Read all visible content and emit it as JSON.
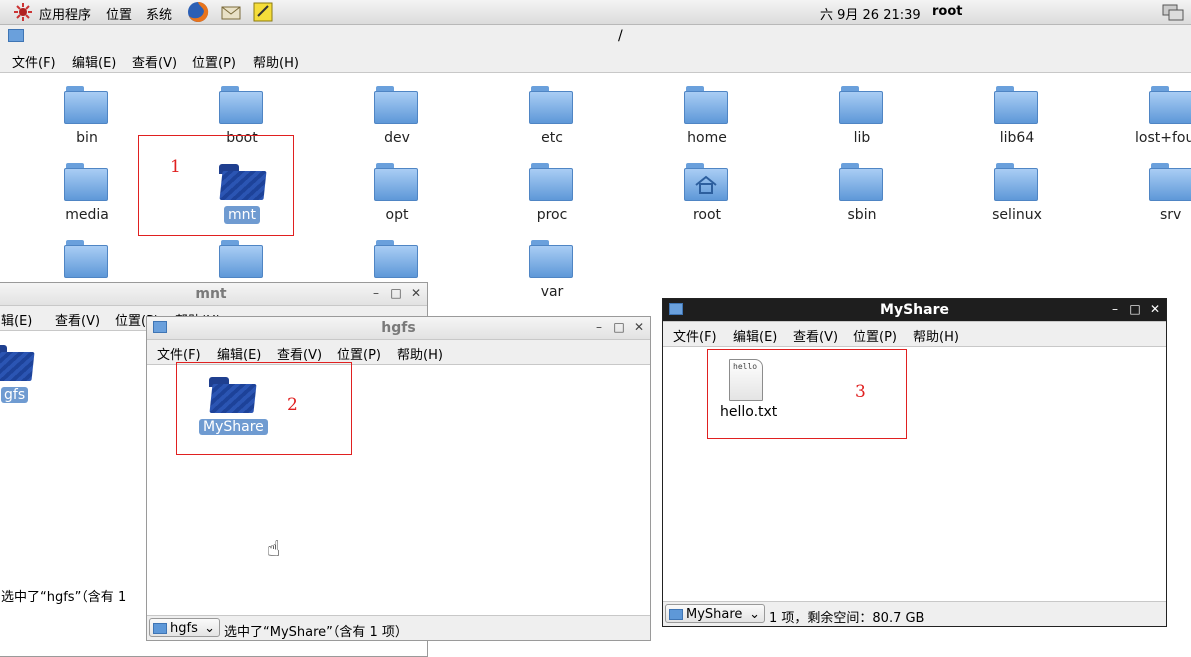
{
  "top_panel": {
    "menus": [
      "应用程序",
      "位置",
      "系统"
    ],
    "clock": "六 9月 26 21:39",
    "user": "root",
    "launchers": [
      "apps-menu-icon",
      "firefox-icon",
      "mail-icon",
      "notes-icon"
    ]
  },
  "main_window": {
    "path": "/",
    "menu": [
      "文件(F)",
      "编辑(E)",
      "查看(V)",
      "位置(P)",
      "帮助(H)"
    ],
    "folders_row1": [
      "bin",
      "boot",
      "dev",
      "etc",
      "home",
      "lib",
      "lib64",
      "lost+fou"
    ],
    "folders_row2": [
      "media",
      "mnt",
      "opt",
      "proc",
      "root",
      "sbin",
      "selinux",
      "srv"
    ],
    "folders_row3_last": "var",
    "selected": "mnt"
  },
  "annotations": {
    "box1": "1",
    "box2": "2",
    "box3": "3"
  },
  "mnt_window": {
    "title": "mnt",
    "menu_partial": [
      "辑(E)",
      "查看(V)",
      "位置(P)",
      "帮助(H)"
    ],
    "folder_label": "gfs",
    "status": "选中了“hgfs”（含有 1"
  },
  "hgfs_window": {
    "title": "hgfs",
    "menu": [
      "文件(F)",
      "编辑(E)",
      "查看(V)",
      "位置(P)",
      "帮助(H)"
    ],
    "folder_label": "MyShare",
    "location": "hgfs",
    "status": "选中了“MyShare”（含有 1 项）"
  },
  "myshare_window": {
    "title": "MyShare",
    "menu": [
      "文件(F)",
      "编辑(E)",
      "查看(V)",
      "位置(P)",
      "帮助(H)"
    ],
    "file_label": "hello.txt",
    "file_preview": "hello",
    "location": "MyShare",
    "status": "1 项，剩余空间：80.7 GB"
  },
  "window_buttons": {
    "minimize": "–",
    "maximize": "□",
    "close": "✕"
  },
  "colors": {
    "folder": "#5e98d8",
    "selected_folder": "#2b55b3",
    "annotation": "#e02020",
    "selection": "#6f9bd1"
  }
}
